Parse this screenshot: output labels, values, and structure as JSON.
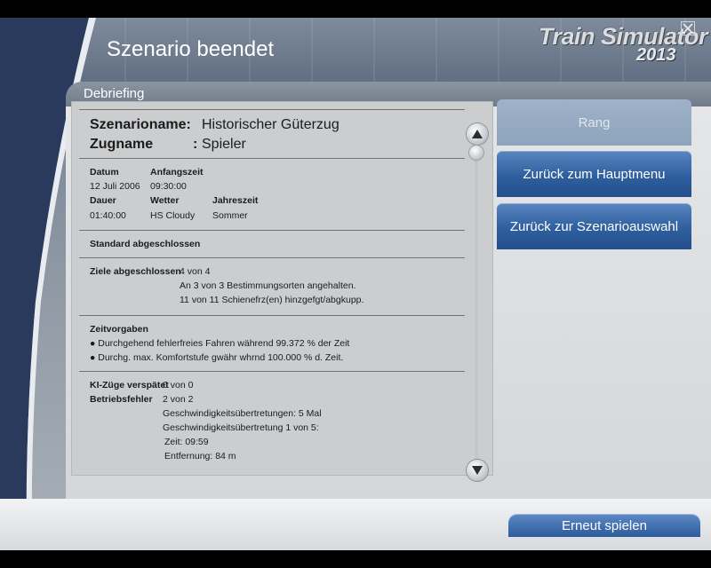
{
  "header": {
    "title": "Szenario beendet",
    "logo_line1": "Train Simulator",
    "logo_line2": "2013"
  },
  "debriefing": {
    "label": "Debriefing"
  },
  "report": {
    "scenario_name_label": "Szenarioname:",
    "scenario_name_value": "Historischer Güterzug",
    "train_name_label": "Zugname",
    "train_name_sep": ":",
    "train_name_value": "Spieler",
    "date_label": "Datum",
    "date_value": "12 Juli 2006",
    "start_label": "Anfangszeit",
    "start_value": "09:30:00",
    "duration_label": "Dauer",
    "duration_value": "01:40:00",
    "weather_label": "Wetter",
    "weather_value": "HS Cloudy",
    "season_label": "Jahreszeit",
    "season_value": "Sommer",
    "standard": "Standard abgeschlossen",
    "goals_label": "Ziele abgeschlossen",
    "goals_value": "4 von 4",
    "goals_line1": "An 3 von 3 Bestimmungsorten angehalten.",
    "goals_line2": "11 von 11 Schienefrz(en) hinzgefgt/abgkupp.",
    "time_heading": "Zeitvorgaben",
    "time_line1": "● Durchgehend fehlerfreies Fahren während 99.372 % der Zeit",
    "time_line2": "● Durchg. max. Komfortstufe gwähr whrnd 100.000 % d. Zeit.",
    "ai_label": "KI-Züge verspätet",
    "ai_value": "0 von 0",
    "faults_label": "Betriebsfehler",
    "faults_value": "2 von 2",
    "faults_line1": "Geschwindigkeitsübertretungen: 5 Mal",
    "faults_line2": "Geschwindigkeitsübertretung 1 von 5:",
    "faults_line3": "Zeit: 09:59",
    "faults_line4": "Entfernung: 84 m"
  },
  "buttons": {
    "rank": "Rang",
    "main_menu": "Zurück zum Hauptmenu",
    "scenario_select": "Zurück zur Szenarioauswahl",
    "replay": "Erneut spielen"
  },
  "colors": {
    "button_blue": "#2f5f9f",
    "button_disabled": "#8ea4bc"
  },
  "icons": {
    "close": "close-icon",
    "scroll_up": "arrow-up-icon",
    "scroll_down": "arrow-down-icon"
  }
}
